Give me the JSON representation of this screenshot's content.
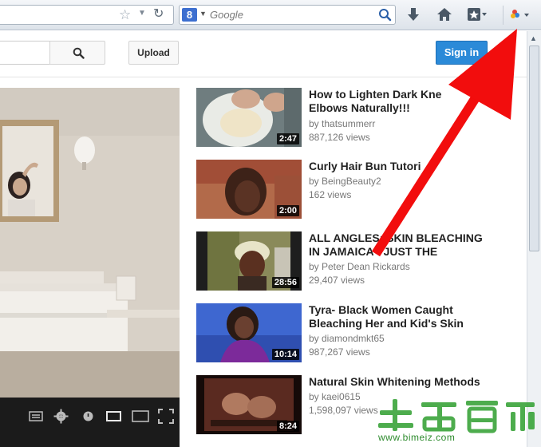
{
  "browser": {
    "search_placeholder": "Google",
    "search_engine_letter": "8"
  },
  "header": {
    "upload_label": "Upload",
    "signin_label": "Sign in"
  },
  "related": [
    {
      "title": "How to Lighten Dark Knees and Elbows Naturally!!!",
      "title_line1": "How to Lighten Dark Kne",
      "title_line2": "Elbows Naturally!!!",
      "channel": "by thatsummerr",
      "views": "887,126 views",
      "duration": "2:47"
    },
    {
      "title": "Curly Hair Bun Tutorial",
      "title_line1": "Curly Hair Bun Tutori",
      "title_line2": "",
      "channel": "by BeingBeauty2",
      "views": "162 views",
      "duration": "2:00"
    },
    {
      "title": "ALL ANGLES: SKIN BLEACHING IN JAMAICA - JUST THE",
      "title_line1": "ALL ANGLES: SKIN BLEACHING",
      "title_line2": "IN JAMAICA - JUST THE",
      "channel": "by Peter Dean Rickards",
      "views": "29,407 views",
      "duration": "28:56"
    },
    {
      "title": "Tyra- Black Women Caught Bleaching Her and Kid's Skin",
      "title_line1": "Tyra- Black Women Caught",
      "title_line2": "Bleaching Her and Kid's Skin",
      "channel": "by diamondmkt65",
      "views": "987,267 views",
      "duration": "10:14"
    },
    {
      "title": "Natural Skin Whitening Methods",
      "title_line1": "Natural Skin Whitening Methods",
      "title_line2": "",
      "channel": "by kaei0615",
      "views": "1,598,097 views",
      "duration": "8:24"
    }
  ],
  "watermark": {
    "site": "www.bimeiz.com",
    "chars": "生活百科"
  },
  "colors": {
    "signin_blue": "#2b8ad8",
    "arrow_red": "#f20d0d",
    "watermark_green": "#2e8b2e"
  }
}
